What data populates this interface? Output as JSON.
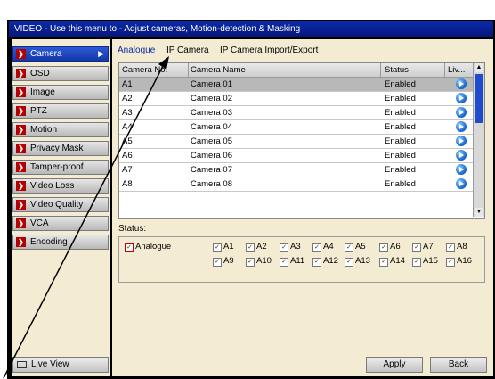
{
  "title": "VIDEO - Use this menu to - Adjust cameras, Motion-detection & Masking",
  "sidebar": {
    "items": [
      {
        "label": "Camera",
        "active": true
      },
      {
        "label": "OSD"
      },
      {
        "label": "Image"
      },
      {
        "label": "PTZ"
      },
      {
        "label": "Motion"
      },
      {
        "label": "Privacy Mask"
      },
      {
        "label": "Tamper-proof"
      },
      {
        "label": "Video Loss"
      },
      {
        "label": "Video Quality"
      },
      {
        "label": "VCA"
      },
      {
        "label": "Encoding"
      }
    ],
    "live_view": "Live View"
  },
  "tabs": [
    "Analogue",
    "IP Camera",
    "IP Camera Import/Export"
  ],
  "table": {
    "headers": [
      "Camera No.",
      "Camera Name",
      "Status",
      "Liv..."
    ],
    "rows": [
      [
        "A1",
        "Camera 01",
        "Enabled"
      ],
      [
        "A2",
        "Camera 02",
        "Enabled"
      ],
      [
        "A3",
        "Camera 03",
        "Enabled"
      ],
      [
        "A4",
        "Camera 04",
        "Enabled"
      ],
      [
        "A5",
        "Camera 05",
        "Enabled"
      ],
      [
        "A6",
        "Camera 06",
        "Enabled"
      ],
      [
        "A7",
        "Camera 07",
        "Enabled"
      ],
      [
        "A8",
        "Camera 08",
        "Enabled"
      ]
    ]
  },
  "status": {
    "label": "Status:",
    "group_label": "Analogue",
    "channels_row1": [
      "A1",
      "A2",
      "A3",
      "A4",
      "A5",
      "A6",
      "A7",
      "A8"
    ],
    "channels_row2": [
      "A9",
      "A10",
      "A11",
      "A12",
      "A13",
      "A14",
      "A15",
      "A16"
    ]
  },
  "buttons": {
    "apply": "Apply",
    "back": "Back"
  },
  "colors": {
    "accent": "#1338a8",
    "panel": "#f4ecd2",
    "chevron": "#b40000"
  }
}
